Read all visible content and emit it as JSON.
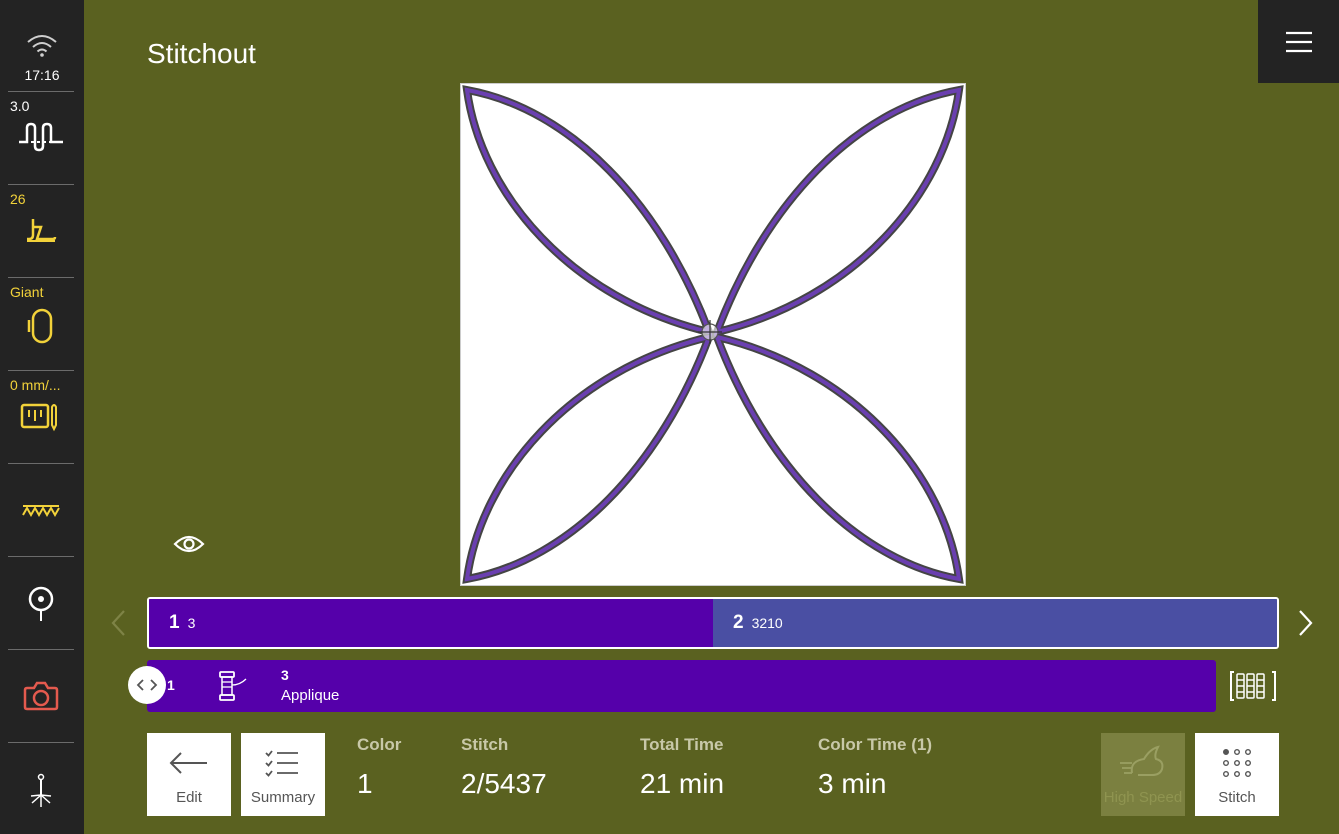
{
  "status": {
    "time": "17:16"
  },
  "sidebar": {
    "stitch_length": "3.0",
    "presser_foot": "26",
    "hoop": "Giant",
    "speed": "0 mm/..."
  },
  "page": {
    "title": "Stitchout"
  },
  "colors": [
    {
      "num": "1",
      "code": "3",
      "color": "#5500aa"
    },
    {
      "num": "2",
      "code": "3210",
      "color": "#4a4fa3"
    }
  ],
  "thread": {
    "index": "1",
    "code": "3",
    "name": "Applique",
    "color": "#5500aa"
  },
  "info": {
    "color_label": "Color",
    "color_value": "1",
    "stitch_label": "Stitch",
    "stitch_value": "2/5437",
    "total_label": "Total Time",
    "total_value": "21 min",
    "colortime_label": "Color Time (1)",
    "colortime_value": "3 min"
  },
  "buttons": {
    "edit": "Edit",
    "summary": "Summary",
    "high_speed": "High Speed",
    "stitch": "Stitch"
  },
  "theme": {
    "background": "#5a6120",
    "sidebar": "#232323",
    "accent_yellow": "#f2d23a",
    "thread_purple": "#5e3a9e"
  }
}
